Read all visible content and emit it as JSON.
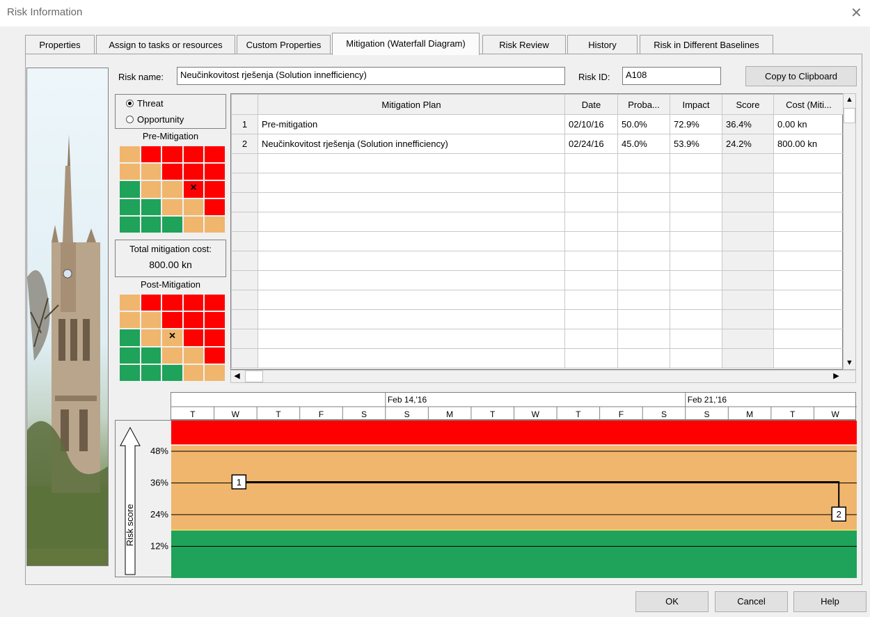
{
  "window": {
    "title": "Risk Information"
  },
  "tabs": [
    {
      "label": "Properties",
      "active": false
    },
    {
      "label": "Assign to tasks or resources",
      "active": false
    },
    {
      "label": "Custom Properties",
      "active": false
    },
    {
      "label": "Mitigation (Waterfall Diagram)",
      "active": true
    },
    {
      "label": "Risk Review",
      "active": false
    },
    {
      "label": "History",
      "active": false
    },
    {
      "label": "Risk in Different Baselines",
      "active": false
    }
  ],
  "form": {
    "risk_name_label": "Risk name:",
    "risk_name_value": "Neučinkovitost rješenja (Solution innefficiency)",
    "risk_id_label": "Risk ID:",
    "risk_id_value": "A108",
    "copy_button": "Copy to Clipboard"
  },
  "risk_type": {
    "threat_label": "Threat",
    "opportunity_label": "Opportunity",
    "selected": "Threat"
  },
  "pre_mitigation": {
    "title": "Pre-Mitigation",
    "matrix": [
      [
        "orange",
        "red",
        "red",
        "red",
        "red"
      ],
      [
        "orange",
        "orange",
        "red",
        "red",
        "red"
      ],
      [
        "green",
        "orange",
        "orange",
        "red",
        "red"
      ],
      [
        "green",
        "green",
        "orange",
        "orange",
        "red"
      ],
      [
        "green",
        "green",
        "green",
        "orange",
        "orange"
      ]
    ],
    "marker_row": 2,
    "marker_col": 3,
    "marker": "×"
  },
  "total_cost": {
    "label": "Total mitigation cost:",
    "value": "800.00 kn"
  },
  "post_mitigation": {
    "title": "Post-Mitigation",
    "matrix": [
      [
        "orange",
        "red",
        "red",
        "red",
        "red"
      ],
      [
        "orange",
        "orange",
        "red",
        "red",
        "red"
      ],
      [
        "green",
        "orange",
        "orange",
        "red",
        "red"
      ],
      [
        "green",
        "green",
        "orange",
        "orange",
        "red"
      ],
      [
        "green",
        "green",
        "green",
        "orange",
        "orange"
      ]
    ],
    "marker_row": 2,
    "marker_col": 2,
    "marker": "×"
  },
  "colors": {
    "red": "#ff0000",
    "orange": "#f0b66d",
    "green": "#1fa25a"
  },
  "table": {
    "headers": [
      "",
      "Mitigation Plan",
      "Date",
      "Proba...",
      "Impact",
      "Score",
      "Cost (Miti..."
    ],
    "rows": [
      [
        "1",
        "Pre-mitigation",
        "02/10/16",
        "50.0%",
        "72.9%",
        "36.4%",
        "0.00 kn"
      ],
      [
        "2",
        "Neučinkovitost rješenja (Solution innefficiency)",
        "02/24/16",
        "45.0%",
        "53.9%",
        "24.2%",
        "800.00 kn"
      ]
    ],
    "empty_rows": 11
  },
  "timeline": {
    "weeks": [
      "Feb 14,'16",
      "Feb 21,'16"
    ],
    "days": [
      "T",
      "W",
      "T",
      "F",
      "S",
      "S",
      "M",
      "T",
      "W",
      "T",
      "F",
      "S",
      "S",
      "M",
      "T",
      "W"
    ]
  },
  "waterfall": {
    "y_axis_label": "Risk score",
    "y_ticks": [
      "48%",
      "36%",
      "24%",
      "12%"
    ],
    "points": [
      {
        "label": "1",
        "date": "02/10/16",
        "score": 36.4
      },
      {
        "label": "2",
        "date": "02/24/16",
        "score": 24.2
      }
    ]
  },
  "buttons": {
    "ok": "OK",
    "cancel": "Cancel",
    "help": "Help"
  }
}
